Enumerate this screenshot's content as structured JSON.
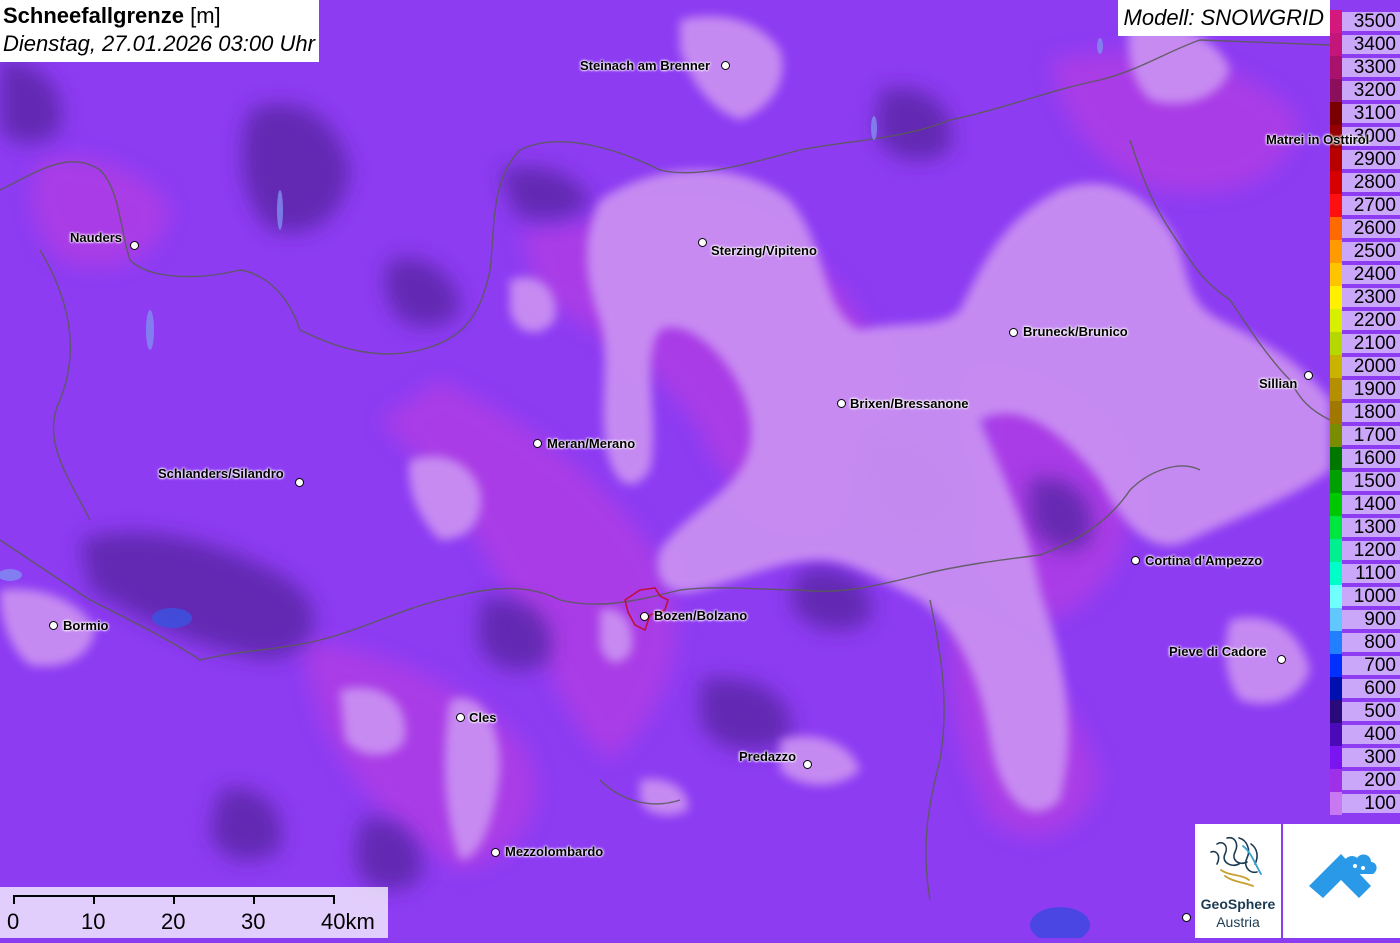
{
  "title": {
    "main": "Schneefallgrenze",
    "unit": "[m]",
    "date": "Dienstag, 27.01.2026 03:00 Uhr"
  },
  "model": "Modell: SNOWGRID",
  "legend": {
    "items": [
      {
        "label": "3500",
        "color": "#d4187e"
      },
      {
        "label": "3400",
        "color": "#c4167a"
      },
      {
        "label": "3300",
        "color": "#a8126c"
      },
      {
        "label": "3200",
        "color": "#8c0f5e"
      },
      {
        "label": "3100",
        "color": "#7a0000"
      },
      {
        "label": "3000",
        "color": "#960000"
      },
      {
        "label": "2900",
        "color": "#b80000"
      },
      {
        "label": "2800",
        "color": "#d60000"
      },
      {
        "label": "2700",
        "color": "#ff1010"
      },
      {
        "label": "2600",
        "color": "#ff6a00"
      },
      {
        "label": "2500",
        "color": "#ff9a00"
      },
      {
        "label": "2400",
        "color": "#ffc400"
      },
      {
        "label": "2300",
        "color": "#fff000"
      },
      {
        "label": "2200",
        "color": "#d8f000"
      },
      {
        "label": "2100",
        "color": "#b4d800"
      },
      {
        "label": "2000",
        "color": "#c8b400"
      },
      {
        "label": "1900",
        "color": "#b49000"
      },
      {
        "label": "1800",
        "color": "#a07800"
      },
      {
        "label": "1700",
        "color": "#7a8c00"
      },
      {
        "label": "1600",
        "color": "#007800"
      },
      {
        "label": "1500",
        "color": "#00a000"
      },
      {
        "label": "1400",
        "color": "#00c800"
      },
      {
        "label": "1300",
        "color": "#00e640"
      },
      {
        "label": "1200",
        "color": "#00f090"
      },
      {
        "label": "1100",
        "color": "#00ffc8"
      },
      {
        "label": "1000",
        "color": "#70ffff"
      },
      {
        "label": "900",
        "color": "#60c8ff"
      },
      {
        "label": "800",
        "color": "#2080ff"
      },
      {
        "label": "700",
        "color": "#0030ff"
      },
      {
        "label": "600",
        "color": "#0010b0"
      },
      {
        "label": "500",
        "color": "#2a0a7a"
      },
      {
        "label": "400",
        "color": "#4a0ab8"
      },
      {
        "label": "300",
        "color": "#7a14f0"
      },
      {
        "label": "200",
        "color": "#a030e8"
      },
      {
        "label": "100",
        "color": "#c878f0"
      }
    ]
  },
  "cities": [
    {
      "name": "Steinach am Brenner"
    },
    {
      "name": "Nauders"
    },
    {
      "name": "Sterzing/Vipiteno"
    },
    {
      "name": "Matrei in Osttirol"
    },
    {
      "name": "Bruneck/Brunico"
    },
    {
      "name": "Sillian"
    },
    {
      "name": "Brixen/Bressanone"
    },
    {
      "name": "Meran/Merano"
    },
    {
      "name": "Schlanders/Silandro"
    },
    {
      "name": "Cortina d'Ampezzo"
    },
    {
      "name": "Bormio"
    },
    {
      "name": "Bozen/Bolzano"
    },
    {
      "name": "Pieve di Cadore"
    },
    {
      "name": "Cles"
    },
    {
      "name": "Predazzo"
    },
    {
      "name": "Mezzolombardo"
    }
  ],
  "scale": {
    "labels": [
      "0",
      "10",
      "20",
      "30",
      "40km"
    ]
  },
  "logo": {
    "name_line1": "GeoSphere",
    "name_line2": "Austria"
  },
  "colors": {
    "light": "#c88cf2",
    "medium": "#9a44f4",
    "pink": "#b036e6",
    "dark": "#6a2ab8",
    "border": "#555555"
  }
}
